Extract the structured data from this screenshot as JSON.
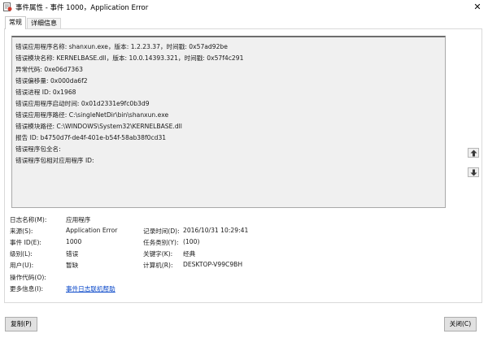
{
  "window": {
    "title": "事件属性 - 事件 1000，Application Error",
    "close_glyph": "✕"
  },
  "tabs": [
    {
      "label": "常规",
      "active": true
    },
    {
      "label": "详细信息",
      "active": false
    }
  ],
  "description_lines": [
    "错误应用程序名称: shanxun.exe，版本: 1.2.23.37，时间戳: 0x57ad92be",
    "错误模块名称: KERNELBASE.dll，版本: 10.0.14393.321，时间戳: 0x57f4c291",
    "异常代码: 0xe06d7363",
    "错误偏移量: 0x000da6f2",
    "错误进程 ID: 0x1968",
    "错误应用程序启动时间: 0x01d2331e9fc0b3d9",
    "错误应用程序路径: C:\\singleNetDir\\bin\\shanxun.exe",
    "错误模块路径: C:\\WINDOWS\\System32\\KERNELBASE.dll",
    "报告 ID: b4750d7f-de4f-401e-b54f-58ab38f0cd31",
    "错误程序包全名:",
    "错误程序包相对应用程序 ID:"
  ],
  "fields": {
    "log_name_label": "日志名称(M):",
    "log_name_value": "应用程序",
    "source_label": "来源(S):",
    "source_value": "Application Error",
    "logged_label": "记录时间(D):",
    "logged_value": "2016/10/31 10:29:41",
    "event_id_label": "事件 ID(E):",
    "event_id_value": "1000",
    "task_label": "任务类别(Y):",
    "task_value": "(100)",
    "level_label": "级别(L):",
    "level_value": "错误",
    "keywords_label": "关键字(K):",
    "keywords_value": "经典",
    "user_label": "用户(U):",
    "user_value": "暂缺",
    "computer_label": "计算机(R):",
    "computer_value": "DESKTOP-V99C9BH",
    "opcode_label": "操作代码(O):",
    "opcode_value": "",
    "more_info_label": "更多信息(I):",
    "more_info_link": "事件日志联机帮助"
  },
  "buttons": {
    "copy": "复制(P)",
    "close": "关闭(C)"
  },
  "icons": {
    "app": "event-properties-icon",
    "up": "arrow-up-icon",
    "down": "arrow-down-icon"
  }
}
